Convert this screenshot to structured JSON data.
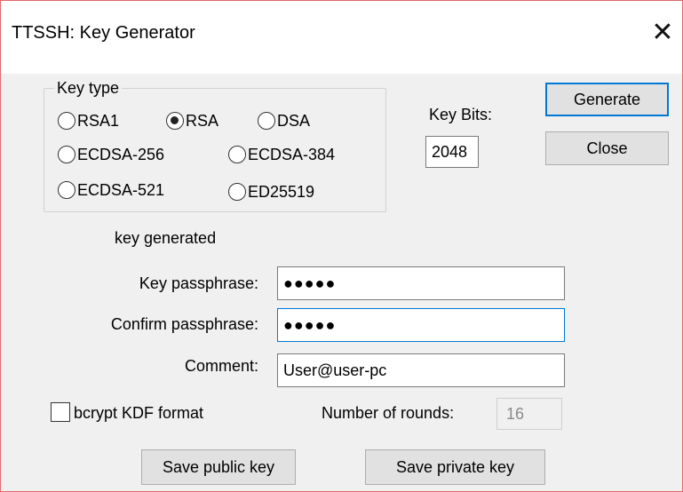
{
  "window": {
    "title": "TTSSH: Key Generator",
    "close_icon": "close-icon"
  },
  "key_type": {
    "group_label": "Key type",
    "options": [
      "RSA1",
      "RSA",
      "DSA",
      "ECDSA-256",
      "ECDSA-384",
      "ECDSA-521",
      "ED25519"
    ],
    "selected": "RSA"
  },
  "key_bits": {
    "label": "Key Bits:",
    "value": "2048"
  },
  "buttons": {
    "generate": "Generate",
    "close": "Close",
    "save_public": "Save public key",
    "save_private": "Save private key"
  },
  "status": "key generated",
  "passphrase": {
    "label": "Key passphrase:",
    "value": "●●●●●"
  },
  "confirm": {
    "label": "Confirm passphrase:",
    "value": "●●●●●"
  },
  "comment": {
    "label": "Comment:",
    "value": "User@user-pc"
  },
  "bcrypt": {
    "label": "bcrypt KDF format",
    "checked": false
  },
  "rounds": {
    "label": "Number of rounds:",
    "value": "16"
  },
  "colors": {
    "focus_border": "#0078d7",
    "window_border": "#e06a6a"
  }
}
